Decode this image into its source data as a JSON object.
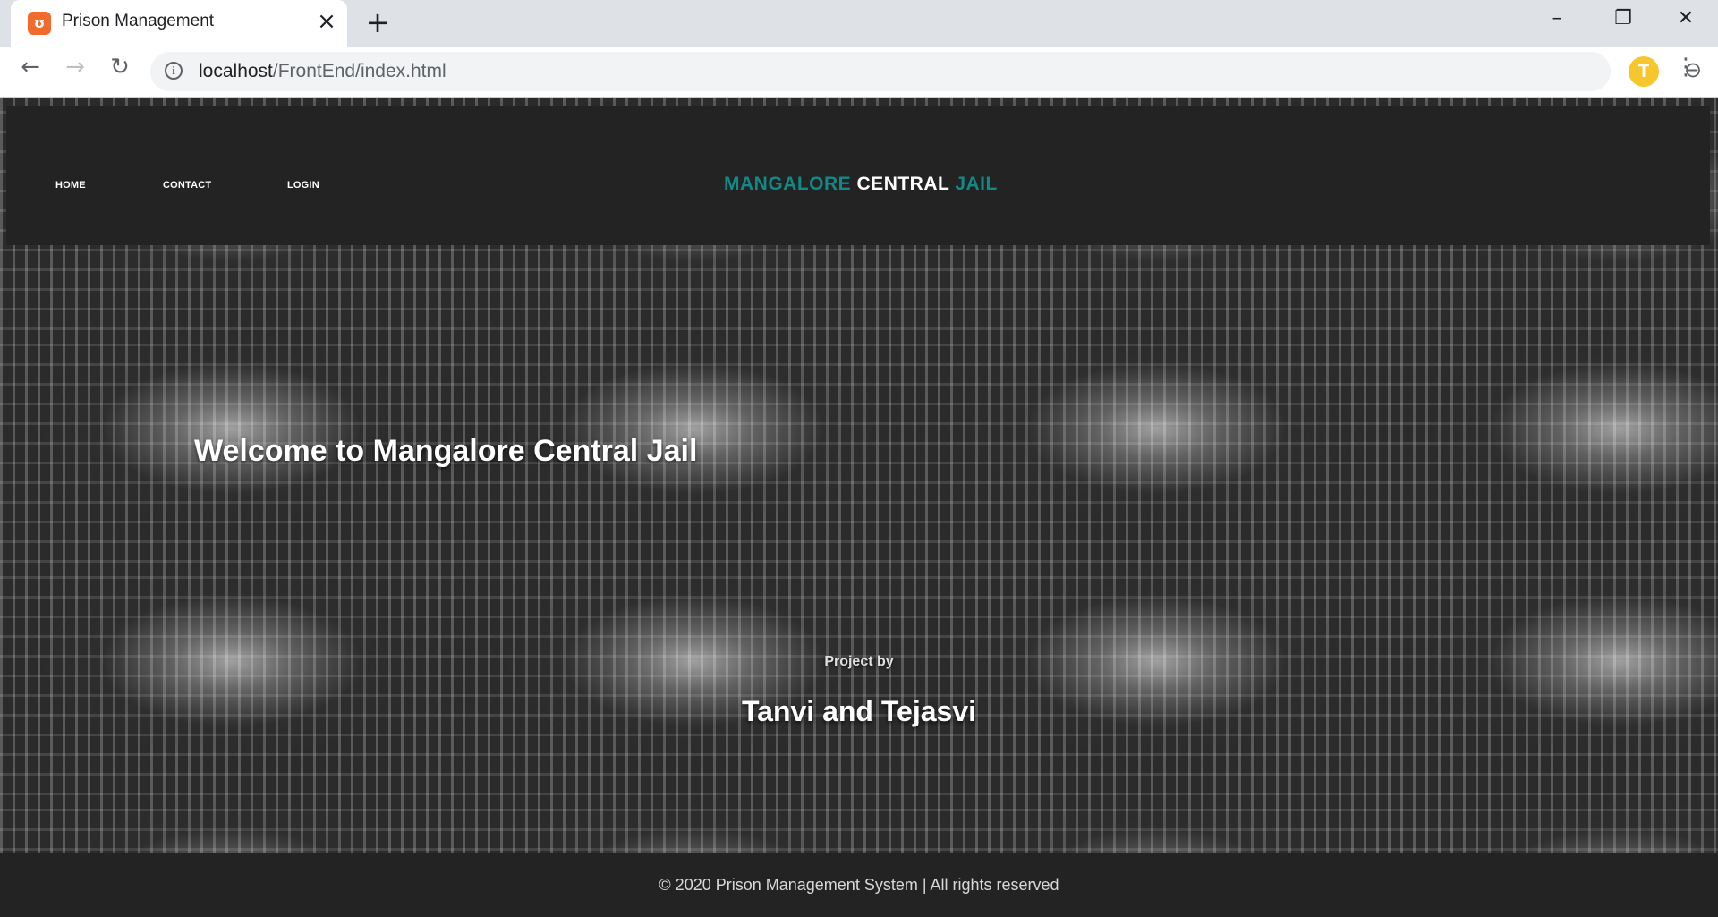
{
  "browser": {
    "tab_title": "Prison Management",
    "tab_favicon": "xampp-icon",
    "url_host": "localhost",
    "url_path": "/FrontEnd/index.html",
    "avatar_letter": "T",
    "icons": [
      "back-icon",
      "forward-icon",
      "reload-icon",
      "info-icon",
      "zoom-out-icon",
      "star-icon",
      "menu-icon",
      "minimize-icon",
      "restore-icon",
      "close-icon",
      "new-tab-icon",
      "tab-close-icon"
    ]
  },
  "header": {
    "nav": [
      "HOME",
      "CONTACT",
      "LOGIN"
    ],
    "brand_part1": "MANGALORE",
    "brand_part2": "CENTRAL",
    "brand_part3": "JAIL"
  },
  "hero": {
    "welcome": "Welcome to Mangalore Central Jail",
    "project_by": "Project by",
    "authors": "Tanvi and Tejasvi"
  },
  "footer": {
    "text": "© 2020 Prison Management System | All rights reserved"
  },
  "colors": {
    "header_bg": "#232323",
    "brand_teal": "#128887",
    "chrome_tab_bar": "#dee1e6",
    "avatar": "#f6c62d"
  }
}
